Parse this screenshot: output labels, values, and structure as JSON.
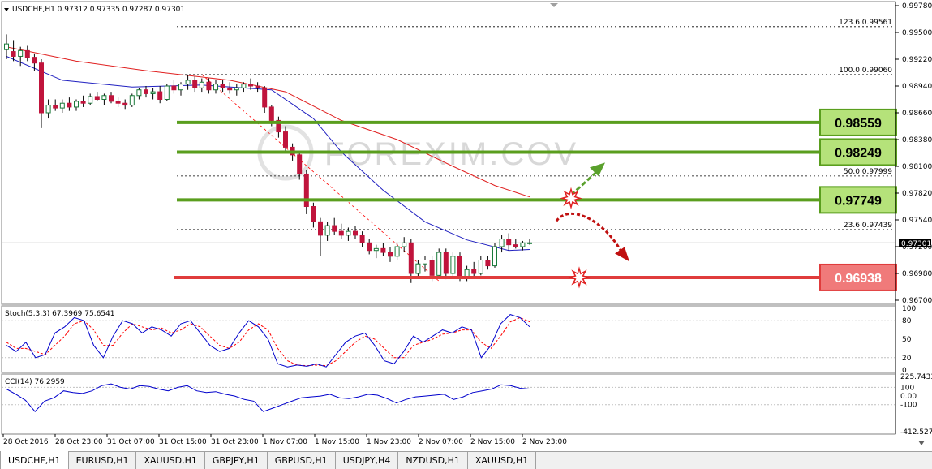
{
  "window": {
    "symbol_header": "USDCHF,H1  0.97312 0.97335 0.97287 0.97301",
    "dropdown_icon": "triangle-down-icon",
    "scroll_marker_icon": "triangle-down-icon"
  },
  "main_axis": {
    "ticks": [
      "0.99780",
      "0.99500",
      "0.99220",
      "0.98940",
      "0.98660",
      "0.98380",
      "0.98100",
      "0.97820",
      "0.97540",
      "0.97260",
      "0.96980",
      "0.96700"
    ],
    "current_price": "0.97301"
  },
  "fib_levels": [
    {
      "label": "123.6  0.99561",
      "price": 0.99561
    },
    {
      "label": "100.0  0.99060",
      "price": 0.9906
    },
    {
      "label": "50.0  0.97999",
      "price": 0.97999
    },
    {
      "label": "23.6  0.97439",
      "price": 0.97439
    }
  ],
  "levels": [
    {
      "label": "0.98559",
      "price": 0.98559,
      "kind": "resistance",
      "color": "#5a9e1e",
      "fill": "#b5e27a"
    },
    {
      "label": "0.98249",
      "price": 0.98249,
      "kind": "resistance",
      "color": "#5a9e1e",
      "fill": "#b5e27a"
    },
    {
      "label": "0.97749",
      "price": 0.97749,
      "kind": "resistance",
      "color": "#5a9e1e",
      "fill": "#b5e27a"
    },
    {
      "label": "0.96938",
      "price": 0.96938,
      "kind": "support",
      "color": "#e03c3c",
      "fill": "#f07a7a"
    }
  ],
  "watermark": {
    "text": "FOREXIM.COV"
  },
  "stoch": {
    "header": "Stoch(5,3,3) 67.3969 75.6541",
    "ticks": [
      "100",
      "80",
      "50",
      "20",
      "0"
    ],
    "main_color": "#0000cc",
    "signal_color": "#ff0000"
  },
  "cci": {
    "header": "CCI(14) 76.2959",
    "ticks": [
      "225.7433",
      "100",
      "0.00",
      "-100",
      "-412.5278"
    ],
    "color": "#0000cc"
  },
  "time_axis": [
    "28 Oct 2016",
    "28 Oct 23:00",
    "31 Oct 07:00",
    "31 Oct 15:00",
    "31 Oct 23:00",
    "1 Nov 07:00",
    "1 Nov 15:00",
    "1 Nov 23:00",
    "2 Nov 07:00",
    "2 Nov 15:00",
    "2 Nov 23:00"
  ],
  "chart_data": {
    "type": "candlestick",
    "symbol": "USDCHF",
    "timeframe": "H1",
    "ylim": [
      0.967,
      0.9978
    ],
    "candles": [
      [
        0.9932,
        0.9948,
        0.9922,
        0.9938
      ],
      [
        0.993,
        0.9942,
        0.992,
        0.9925
      ],
      [
        0.9925,
        0.9935,
        0.9915,
        0.9931
      ],
      [
        0.9931,
        0.9936,
        0.992,
        0.9924
      ],
      [
        0.9924,
        0.9928,
        0.991,
        0.9918
      ],
      [
        0.9918,
        0.9922,
        0.985,
        0.9866
      ],
      [
        0.9866,
        0.988,
        0.986,
        0.9874
      ],
      [
        0.9874,
        0.988,
        0.9868,
        0.9871
      ],
      [
        0.9871,
        0.988,
        0.9866,
        0.9876
      ],
      [
        0.9876,
        0.9882,
        0.9868,
        0.9872
      ],
      [
        0.9872,
        0.988,
        0.9868,
        0.9878
      ],
      [
        0.9878,
        0.9884,
        0.9872,
        0.9876
      ],
      [
        0.9876,
        0.9886,
        0.9874,
        0.9883
      ],
      [
        0.9883,
        0.9888,
        0.9878,
        0.988
      ],
      [
        0.988,
        0.9886,
        0.9874,
        0.9884
      ],
      [
        0.9884,
        0.9888,
        0.9876,
        0.9878
      ],
      [
        0.9878,
        0.9882,
        0.9872,
        0.9876
      ],
      [
        0.9876,
        0.988,
        0.987,
        0.9874
      ],
      [
        0.9874,
        0.9886,
        0.9872,
        0.9884
      ],
      [
        0.9884,
        0.9892,
        0.988,
        0.989
      ],
      [
        0.989,
        0.9894,
        0.9882,
        0.9886
      ],
      [
        0.9886,
        0.9892,
        0.988,
        0.9888
      ],
      [
        0.9888,
        0.9894,
        0.9876,
        0.988
      ],
      [
        0.988,
        0.9896,
        0.9878,
        0.9894
      ],
      [
        0.9894,
        0.99,
        0.9886,
        0.989
      ],
      [
        0.989,
        0.9898,
        0.9884,
        0.9896
      ],
      [
        0.9896,
        0.9906,
        0.989,
        0.99
      ],
      [
        0.99,
        0.9904,
        0.9888,
        0.9892
      ],
      [
        0.9892,
        0.9902,
        0.9888,
        0.9898
      ],
      [
        0.9898,
        0.9902,
        0.9886,
        0.989
      ],
      [
        0.989,
        0.99,
        0.9886,
        0.9896
      ],
      [
        0.9896,
        0.99,
        0.9888,
        0.9892
      ],
      [
        0.9892,
        0.9898,
        0.9886,
        0.989
      ],
      [
        0.989,
        0.9896,
        0.9884,
        0.9892
      ],
      [
        0.9892,
        0.9898,
        0.9888,
        0.9896
      ],
      [
        0.9896,
        0.9902,
        0.989,
        0.9894
      ],
      [
        0.9894,
        0.9898,
        0.9888,
        0.9892
      ],
      [
        0.9892,
        0.9894,
        0.9866,
        0.9872
      ],
      [
        0.9872,
        0.9874,
        0.9852,
        0.9858
      ],
      [
        0.9858,
        0.9862,
        0.984,
        0.9846
      ],
      [
        0.9846,
        0.9852,
        0.9824,
        0.983
      ],
      [
        0.983,
        0.9834,
        0.9816,
        0.9822
      ],
      [
        0.9822,
        0.9826,
        0.9796,
        0.9802
      ],
      [
        0.9802,
        0.9806,
        0.976,
        0.9768
      ],
      [
        0.9768,
        0.9772,
        0.9746,
        0.9752
      ],
      [
        0.9752,
        0.9756,
        0.9716,
        0.9738
      ],
      [
        0.9738,
        0.9752,
        0.9732,
        0.9748
      ],
      [
        0.9748,
        0.9756,
        0.9738,
        0.9742
      ],
      [
        0.9742,
        0.975,
        0.9734,
        0.9738
      ],
      [
        0.9738,
        0.9746,
        0.9732,
        0.9742
      ],
      [
        0.9742,
        0.9748,
        0.9734,
        0.9738
      ],
      [
        0.9738,
        0.9742,
        0.9726,
        0.973
      ],
      [
        0.973,
        0.9734,
        0.9718,
        0.9722
      ],
      [
        0.9722,
        0.9728,
        0.9714,
        0.9724
      ],
      [
        0.9724,
        0.973,
        0.9716,
        0.972
      ],
      [
        0.972,
        0.9726,
        0.971,
        0.9716
      ],
      [
        0.9716,
        0.973,
        0.9712,
        0.9726
      ],
      [
        0.9726,
        0.9736,
        0.972,
        0.973
      ],
      [
        0.973,
        0.9734,
        0.9688,
        0.9698
      ],
      [
        0.9698,
        0.9712,
        0.9694,
        0.9708
      ],
      [
        0.9708,
        0.9716,
        0.97,
        0.9712
      ],
      [
        0.9712,
        0.9716,
        0.969,
        0.9696
      ],
      [
        0.9696,
        0.9724,
        0.9694,
        0.972
      ],
      [
        0.972,
        0.9724,
        0.9692,
        0.9698
      ],
      [
        0.9698,
        0.972,
        0.9694,
        0.9716
      ],
      [
        0.9716,
        0.972,
        0.969,
        0.9694
      ],
      [
        0.9694,
        0.9706,
        0.969,
        0.9702
      ],
      [
        0.9702,
        0.971,
        0.9694,
        0.9698
      ],
      [
        0.9698,
        0.9716,
        0.9696,
        0.9712
      ],
      [
        0.9712,
        0.9716,
        0.9702,
        0.9706
      ],
      [
        0.9706,
        0.973,
        0.9704,
        0.9726
      ],
      [
        0.9726,
        0.9738,
        0.972,
        0.9734
      ],
      [
        0.9734,
        0.974,
        0.9722,
        0.9728
      ],
      [
        0.9728,
        0.9734,
        0.9724,
        0.9726
      ],
      [
        0.9726,
        0.9732,
        0.9722,
        0.973
      ],
      [
        0.973,
        0.9734,
        0.9728,
        0.973
      ]
    ],
    "ma_fast": [
      [
        0,
        0.9925
      ],
      [
        8,
        0.99
      ],
      [
        18,
        0.9893
      ],
      [
        28,
        0.9895
      ],
      [
        38,
        0.989
      ],
      [
        44,
        0.986
      ],
      [
        48,
        0.9825
      ],
      [
        54,
        0.9785
      ],
      [
        60,
        0.9752
      ],
      [
        66,
        0.9733
      ],
      [
        72,
        0.9722
      ],
      [
        75,
        0.9723
      ]
    ],
    "ma_slow": [
      [
        0,
        0.9935
      ],
      [
        10,
        0.992
      ],
      [
        20,
        0.991
      ],
      [
        32,
        0.99
      ],
      [
        40,
        0.9888
      ],
      [
        48,
        0.9858
      ],
      [
        56,
        0.9838
      ],
      [
        64,
        0.981
      ],
      [
        70,
        0.979
      ],
      [
        75,
        0.9778
      ]
    ],
    "stoch_main": [
      40,
      30,
      45,
      20,
      25,
      60,
      70,
      85,
      80,
      40,
      20,
      55,
      80,
      75,
      60,
      70,
      65,
      55,
      75,
      80,
      60,
      40,
      30,
      35,
      60,
      80,
      70,
      50,
      10,
      5,
      8,
      6,
      10,
      5,
      25,
      45,
      55,
      60,
      40,
      15,
      10,
      30,
      55,
      45,
      55,
      65,
      60,
      70,
      65,
      20,
      40,
      75,
      90,
      85,
      70
    ],
    "stoch_signal": [
      45,
      35,
      35,
      30,
      25,
      40,
      55,
      75,
      80,
      65,
      40,
      40,
      60,
      75,
      70,
      65,
      68,
      60,
      65,
      75,
      70,
      55,
      40,
      35,
      45,
      65,
      75,
      65,
      35,
      15,
      8,
      7,
      8,
      7,
      15,
      30,
      45,
      55,
      50,
      35,
      20,
      20,
      40,
      45,
      50,
      58,
      60,
      65,
      65,
      45,
      35,
      55,
      78,
      85,
      78
    ],
    "cci": [
      80,
      20,
      -50,
      -180,
      -60,
      -20,
      60,
      40,
      30,
      60,
      120,
      140,
      100,
      80,
      120,
      110,
      80,
      60,
      100,
      120,
      60,
      40,
      50,
      20,
      0,
      -40,
      -60,
      -180,
      -140,
      -100,
      -60,
      -20,
      -10,
      0,
      20,
      -20,
      -30,
      -10,
      20,
      10,
      -30,
      -80,
      -40,
      -10,
      0,
      10,
      20,
      -40,
      -10,
      40,
      60,
      80,
      130,
      120,
      90,
      80
    ]
  }
}
